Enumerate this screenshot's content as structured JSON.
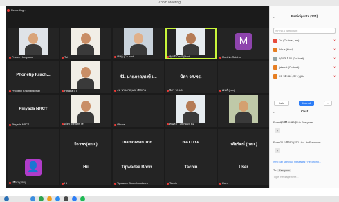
{
  "window": {
    "title": "Zoom Meeting",
    "recording": "Recording..."
  },
  "tiles": [
    {
      "name": "Pranee Hongsakul",
      "kind": "video"
    },
    {
      "name": "Tui",
      "kind": "video"
    },
    {
      "name": "เจษฎ์ (Co-host)",
      "kind": "video"
    },
    {
      "name": "คุณชัยวัฒน์ (Host)",
      "kind": "video",
      "active": true
    },
    {
      "name": "Monthip Ratcha",
      "kind": "avatar",
      "letter": "M",
      "color": "#8e44ad"
    },
    {
      "name": "Phonetip Krachangkwan",
      "kind": "name",
      "big": "Phonetip Krach..."
    },
    {
      "name": "Hthapat ( )",
      "kind": "video"
    },
    {
      "name": "41. นายภาณุพงษ์ เลิศยาม",
      "kind": "name",
      "big": "41. นายภาณุพงษ์ เ..."
    },
    {
      "name": "นิดา วศ.พธ.",
      "kind": "name",
      "big": "นิดา วศ.พธ."
    },
    {
      "name": "เจนต์ (Luc)",
      "kind": "name",
      "big": ""
    },
    {
      "name": "Pinyada NRCT",
      "kind": "name",
      "big": "Pinyada NRCT"
    },
    {
      "name": "เกียร (Benaris M)",
      "kind": "video"
    },
    {
      "name": "iPhone",
      "kind": "name",
      "big": ""
    },
    {
      "name": "คุณศิลา ไพตรอวด ทีม",
      "kind": "video"
    },
    {
      "name": "",
      "kind": "video"
    },
    {
      "name": "ภาวนา ทำงาน สถ.",
      "kind": "name",
      "big": ""
    },
    {
      "name": "จิราพร(สกว.)",
      "kind": "name",
      "big": "จิราพร(สกว.)"
    },
    {
      "name": "Thamolwan Tongpradub",
      "kind": "name",
      "big": "Thamolwan Ton..."
    },
    {
      "name": "RATTIYA",
      "kind": "name",
      "big": "RATTIYA"
    },
    {
      "name": "วลัย วัลย์ (กสว.)",
      "kind": "name",
      "big": "วลัยรัตน์ (กสว.)"
    },
    {
      "name": "ปรีณา (สกว)",
      "kind": "avatar",
      "letter": "",
      "color": "#b03cc9"
    },
    {
      "name": "Hii",
      "kind": "name",
      "big": "Hii"
    },
    {
      "name": "Tipwadee Boonchoochuen",
      "kind": "name",
      "big": "Tipwadee Boon..."
    },
    {
      "name": "Tachin",
      "kind": "name",
      "big": "Tachin"
    },
    {
      "name": "User",
      "kind": "name",
      "big": "User"
    }
  ],
  "participants": {
    "header": "Participants (224)",
    "search_placeholder": "Find a participant",
    "rows": [
      {
        "name": "Tui (Co-host, me)",
        "color": "#e74c3c"
      },
      {
        "name": "Wcus (Host)",
        "color": "#e67e22"
      },
      {
        "name": "คุณชัย นิภา (Co-host)",
        "color": "#95a5a6"
      },
      {
        "name": "jatamat (Co-host)",
        "color": "#e67e22"
      },
      {
        "name": "จร. บดินทร์ (สกว.) (Ho...",
        "color": "#e67e22"
      }
    ],
    "buttons": [
      "Invite",
      "Mute All",
      "..."
    ]
  },
  "chat": {
    "header": "Chat",
    "messages": [
      {
        "from": "From คุณศิริ มงคลสุข to Everyone:",
        "text": "?"
      },
      {
        "from": "From 20. นพิตรา (สกว.) to... to Everyone:",
        "text": "?"
      }
    ],
    "who_can_see": "Who can see your messages? Recording...",
    "to_label": "To:",
    "to_value": "Everyone",
    "input_placeholder": "Type message here..."
  }
}
